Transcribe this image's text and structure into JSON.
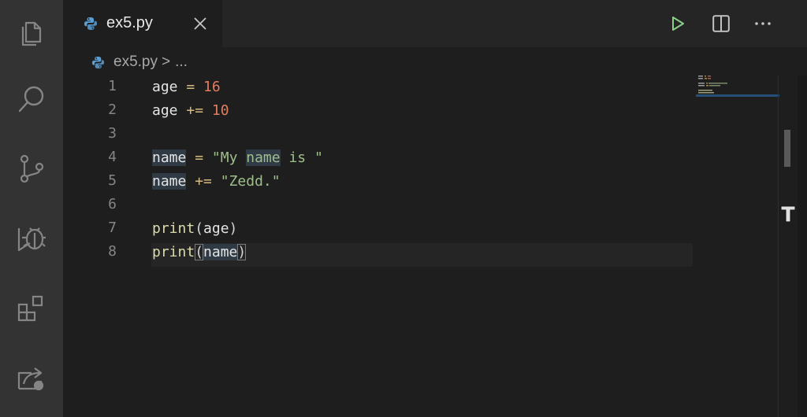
{
  "tab": {
    "filename": "ex5.py"
  },
  "breadcrumb": {
    "filename": "ex5.py",
    "separator": ">",
    "more": "..."
  },
  "editor": {
    "lines": [
      {
        "number": "1",
        "text": "age = 16"
      },
      {
        "number": "2",
        "text": "age += 10"
      },
      {
        "number": "3",
        "text": ""
      },
      {
        "number": "4",
        "text": "name = \"My name is \""
      },
      {
        "number": "5",
        "text": "name += \"Zedd.\""
      },
      {
        "number": "6",
        "text": ""
      },
      {
        "number": "7",
        "text": "print(age)"
      },
      {
        "number": "8",
        "text": "print(name)"
      }
    ],
    "active_line": "8"
  },
  "icons": {
    "activity_bar": [
      "explorer-icon",
      "search-icon",
      "source-control-icon",
      "run-debug-icon",
      "extensions-icon",
      "remote-explorer-icon"
    ],
    "editor_actions": [
      "run-icon",
      "split-editor-icon",
      "more-actions-icon"
    ]
  },
  "colors": {
    "keyword_operator": "#d7ba7d",
    "number": "#e27d5d",
    "string": "#ce9178",
    "function": "#dcdcaa",
    "run_green": "#89d185"
  }
}
